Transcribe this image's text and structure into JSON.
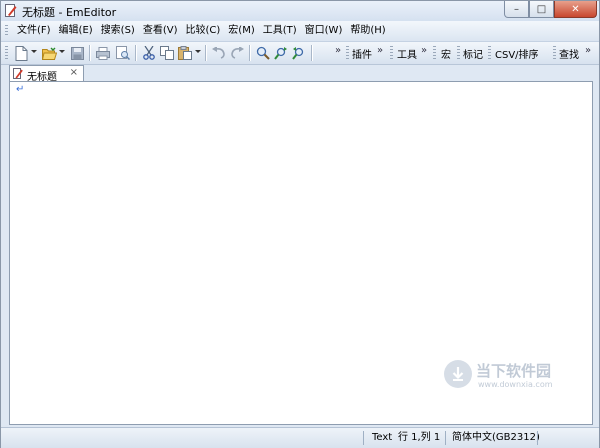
{
  "window": {
    "title": "无标题 - EmEditor",
    "controls": {
      "minimize": "–",
      "maximize": "□",
      "close": "✕"
    }
  },
  "menu": {
    "items": [
      {
        "label": "文件(F)"
      },
      {
        "label": "编辑(E)"
      },
      {
        "label": "搜索(S)"
      },
      {
        "label": "查看(V)"
      },
      {
        "label": "比较(C)"
      },
      {
        "label": "宏(M)"
      },
      {
        "label": "工具(T)"
      },
      {
        "label": "窗口(W)"
      },
      {
        "label": "帮助(H)"
      }
    ]
  },
  "toolbar": {
    "chevron": "»",
    "plugins_label": "插件",
    "tools_label": "工具",
    "macro_label": "宏",
    "marker_label": "标记",
    "csv_label": "CSV/排序",
    "find_label": "查找"
  },
  "tabs": [
    {
      "label": "无标题",
      "close": "×"
    }
  ],
  "editor": {
    "eol_mark": "↵"
  },
  "watermark": {
    "title": "当下软件园",
    "subtitle": "www.downxia.com"
  },
  "statusbar": {
    "mode": "Text",
    "position": "行 1,列 1",
    "encoding": "简体中文(GB2312)"
  },
  "colors": {
    "accent": "#3a6fd8",
    "close_button": "#c8472e"
  }
}
